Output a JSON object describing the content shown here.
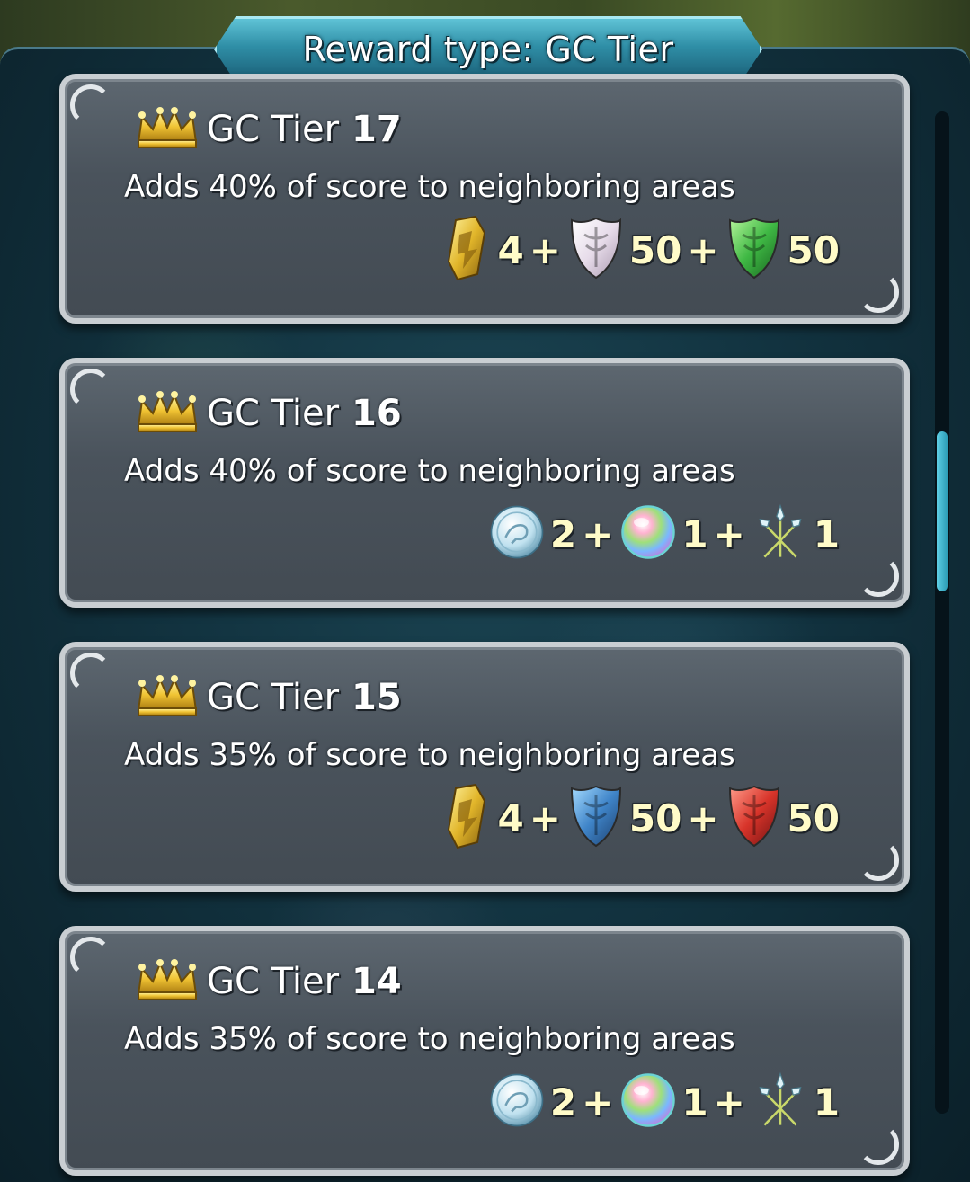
{
  "header": {
    "title": "Reward type: GC Tier"
  },
  "colors": {
    "panel_bg": "#123340",
    "card_bg": "#4a535c",
    "card_border": "#c9ced2",
    "header_bg": "#2f8ea6",
    "reward_text": "#fffbc8"
  },
  "tier_prefix": "GC Tier",
  "cards": [
    {
      "tier": "17",
      "description": "Adds 40% of score to neighboring areas",
      "rewards": [
        {
          "icon": "gold-badge-icon",
          "value": "4"
        },
        {
          "icon": "white-crest-shield-icon",
          "value": "50"
        },
        {
          "icon": "green-crest-shield-icon",
          "value": "50"
        }
      ]
    },
    {
      "tier": "16",
      "description": "Adds 40% of score to neighboring areas",
      "rewards": [
        {
          "icon": "silver-coin-icon",
          "value": "2"
        },
        {
          "icon": "rainbow-orb-icon",
          "value": "1"
        },
        {
          "icon": "triple-lance-icon",
          "value": "1"
        }
      ]
    },
    {
      "tier": "15",
      "description": "Adds 35% of score to neighboring areas",
      "rewards": [
        {
          "icon": "gold-badge-icon",
          "value": "4"
        },
        {
          "icon": "blue-crest-shield-icon",
          "value": "50"
        },
        {
          "icon": "red-crest-shield-icon",
          "value": "50"
        }
      ]
    },
    {
      "tier": "14",
      "description": "Adds 35% of score to neighboring areas",
      "rewards": [
        {
          "icon": "silver-coin-icon",
          "value": "2"
        },
        {
          "icon": "rainbow-orb-icon",
          "value": "1"
        },
        {
          "icon": "triple-lance-icon",
          "value": "1"
        }
      ]
    }
  ],
  "plus_sign": "+",
  "scrollbar": {
    "position": 0.38,
    "visible_fraction": 0.16
  }
}
